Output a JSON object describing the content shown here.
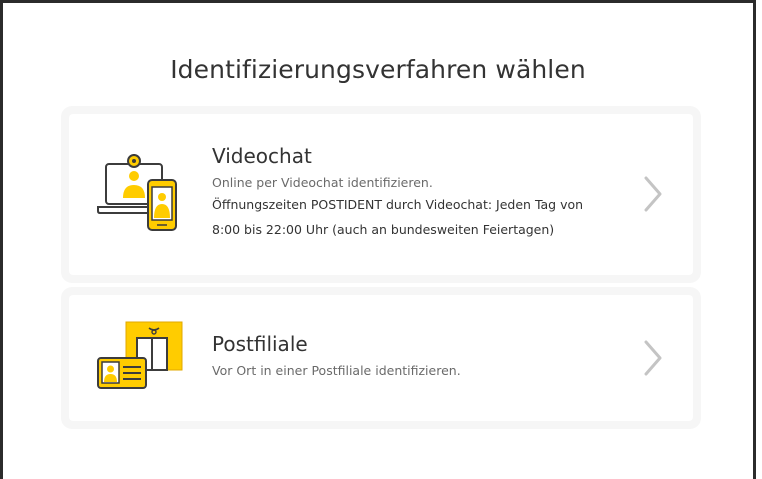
{
  "page": {
    "title": "Identifizierungsverfahren wählen"
  },
  "options": [
    {
      "title": "Videochat",
      "subtitle": "Online per Videochat identifizieren.",
      "detail": "Öffnungszeiten POSTIDENT durch Videochat: Jeden Tag von 8:00 bis 22:00 Uhr (auch an bundesweiten Feiertagen)",
      "icon": "videochat-icon"
    },
    {
      "title": "Postfiliale",
      "subtitle": "Vor Ort in einer Postfiliale identifizieren.",
      "icon": "post-office-icon"
    }
  ],
  "colors": {
    "accent": "#ffcc00",
    "accent_dark": "#e0a800",
    "line": "#3c3c3c",
    "chevron": "#c4c4c4"
  }
}
